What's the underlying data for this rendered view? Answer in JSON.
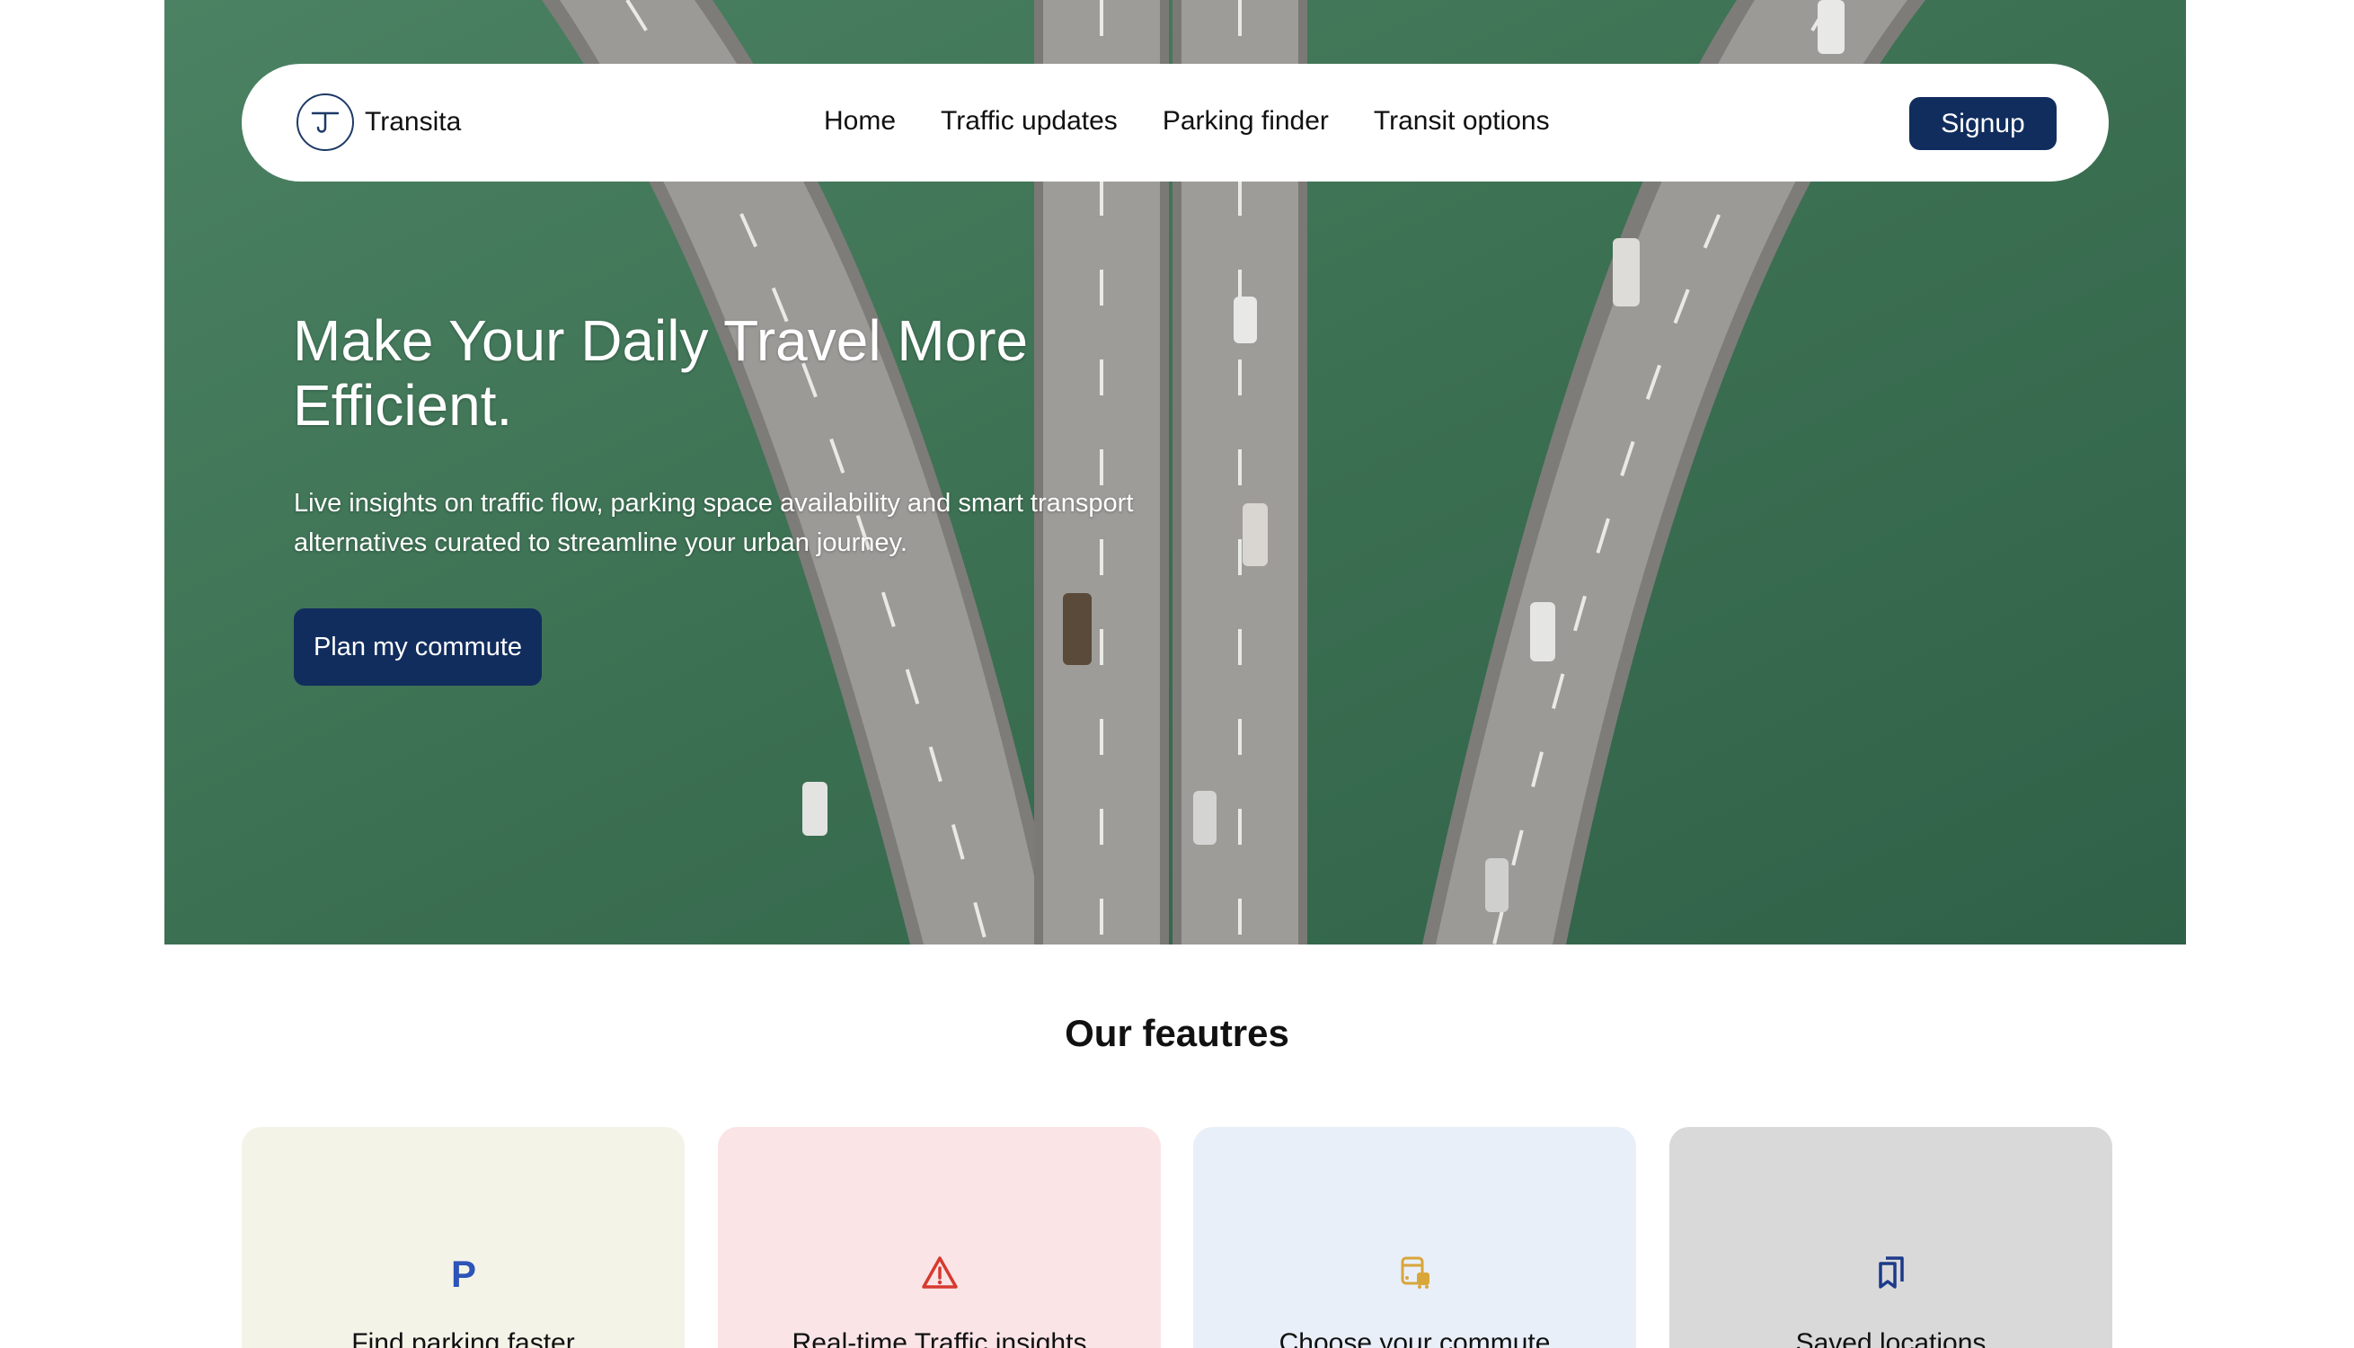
{
  "header": {
    "brand": "Transita",
    "logo_icon": "t-route-logo-icon",
    "nav": [
      {
        "label": "Home"
      },
      {
        "label": "Traffic updates"
      },
      {
        "label": "Parking finder"
      },
      {
        "label": "Transit options"
      }
    ],
    "signup_label": "Signup"
  },
  "hero": {
    "title_line1": "Make Your Daily Travel More",
    "title_line2": "Efficient.",
    "subtitle_line1": "Live insights on traffic flow, parking space availability and smart transport",
    "subtitle_line2": "alternatives curated to streamline your urban journey.",
    "cta_label": "Plan my commute",
    "background": "aerial-highway-over-water-image"
  },
  "features": {
    "title": "Our feautres",
    "cards": [
      {
        "label": "Find parking faster",
        "icon": "parking-icon",
        "bg": "#f4f3e8",
        "icon_color": "#2d55b8"
      },
      {
        "label": "Real-time Traffic insights",
        "icon": "warning-triangle-icon",
        "bg": "#fae4e6",
        "icon_color": "#d63a2f"
      },
      {
        "label": "Choose your commute",
        "icon": "bus-icon",
        "bg": "#e8eff9",
        "icon_color": "#d9a63a"
      },
      {
        "label": "Saved locations",
        "icon": "bookmarks-icon",
        "bg": "#d9d9d9",
        "icon_color": "#1d3a8a"
      }
    ]
  },
  "colors": {
    "primary": "#112d5e",
    "water": "#3f7558"
  }
}
